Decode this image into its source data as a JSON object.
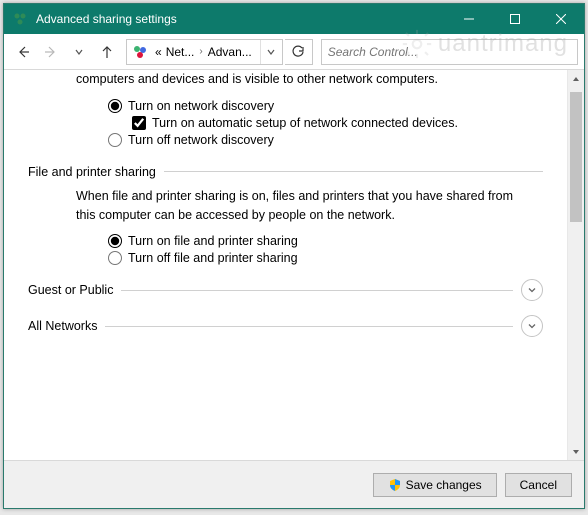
{
  "window": {
    "title": "Advanced sharing settings"
  },
  "nav": {
    "crumb_prefix": "«",
    "crumb1": "Net...",
    "crumb2": "Advan..."
  },
  "search": {
    "placeholder": "Search Control..."
  },
  "content": {
    "intro_text": "computers and devices and is visible to other network computers.",
    "net_discovery": {
      "on_label": "Turn on network discovery",
      "auto_label": "Turn on automatic setup of network connected devices.",
      "off_label": "Turn off network discovery"
    },
    "file_printer": {
      "header": "File and printer sharing",
      "desc": "When file and printer sharing is on, files and printers that you have shared from this computer can be accessed by people on the network.",
      "on_label": "Turn on file and printer sharing",
      "off_label": "Turn off file and printer sharing"
    },
    "guest_label": "Guest or Public",
    "all_label": "All Networks"
  },
  "footer": {
    "save_label": "Save changes",
    "cancel_label": "Cancel"
  },
  "watermark": "uantrimang"
}
